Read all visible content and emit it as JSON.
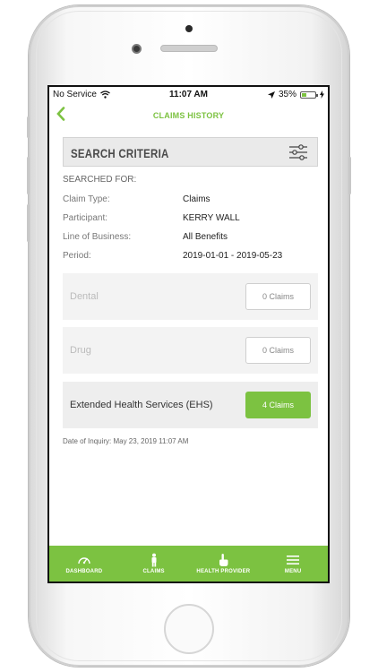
{
  "status_bar": {
    "carrier": "No Service",
    "time": "11:07 AM",
    "battery_pct": "35%",
    "battery_level": 0.35
  },
  "nav": {
    "back_icon": "chevron-left-icon",
    "title": "CLAIMS HISTORY"
  },
  "search": {
    "title": "SEARCH CRITERIA",
    "filter_icon": "sliders-icon"
  },
  "criteria": {
    "heading": "SEARCHED FOR:",
    "rows": [
      {
        "label": "Claim Type:",
        "value": "Claims"
      },
      {
        "label": "Participant:",
        "value": "KERRY WALL"
      },
      {
        "label": "Line of Business:",
        "value": "All Benefits"
      },
      {
        "label": "Period:",
        "value": "2019-01-01 - 2019-05-23"
      }
    ]
  },
  "claims": [
    {
      "name": "Dental",
      "count_label": "0 Claims",
      "active": false
    },
    {
      "name": "Drug",
      "count_label": "0 Claims",
      "active": false
    },
    {
      "name": "Extended Health Services (EHS)",
      "count_label": "4 Claims",
      "active": true
    }
  ],
  "inquiry": "Date of Inquiry: May 23, 2019 11:07 AM",
  "tabs": [
    {
      "label": "DASHBOARD",
      "icon": "gauge-icon"
    },
    {
      "label": "CLAIMS",
      "icon": "person-icon"
    },
    {
      "label": "HEALTH PROVIDER",
      "icon": "hand-pointer-icon"
    },
    {
      "label": "MENU",
      "icon": "hamburger-icon"
    }
  ],
  "colors": {
    "accent": "#7cc241",
    "card_bg": "#f3f3f3",
    "search_bg": "#eaeaea"
  }
}
